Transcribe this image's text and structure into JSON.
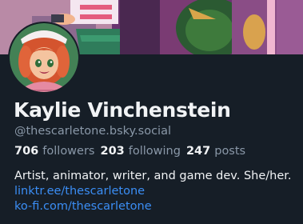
{
  "profile": {
    "display_name": "Kaylie Vinchenstein",
    "handle": "@thescarletone.bsky.social",
    "stats": [
      {
        "value": "706",
        "label": "followers"
      },
      {
        "value": "203",
        "label": "following"
      },
      {
        "value": "247",
        "label": "posts"
      }
    ],
    "bio": "Artist, animator, writer, and game dev. She/her.",
    "links": [
      "linktr.ee/thescarletone",
      "ko-fi.com/thescarletone"
    ]
  },
  "colors": {
    "background": "#161e27",
    "text": "#f1f3f5",
    "muted": "#8a98a8",
    "link": "#3b8ef5"
  }
}
